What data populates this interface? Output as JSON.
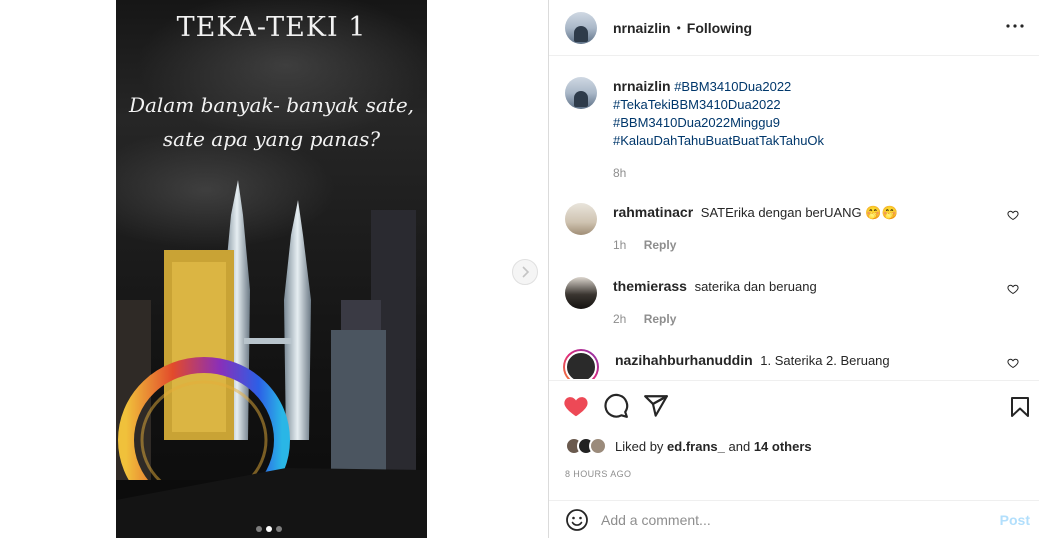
{
  "post": {
    "photo_title": "TEKA-TEKI 1",
    "photo_question_line1": "Dalam banyak- banyak sate,",
    "photo_question_line2": "sate apa yang panas?",
    "carousel_dots": 3,
    "carousel_active": 2
  },
  "header": {
    "username": "nrnaizlin",
    "separator": "•",
    "follow_status": "Following"
  },
  "caption": {
    "username": "nrnaizlin",
    "hashtags": [
      "#BBM3410Dua2022",
      "#TekaTekiBBM3410Dua2022",
      "#BBM3410Dua2022Minggu9",
      "#KalauDahTahuBuatBuatTakTahuOk"
    ],
    "time": "8h"
  },
  "comments": [
    {
      "username": "rahmatinacr",
      "text": "SATErika dengan berUANG 🤭🤭",
      "time": "1h",
      "reply": "Reply"
    },
    {
      "username": "themierass",
      "text": "saterika dan beruang",
      "time": "2h",
      "reply": "Reply"
    },
    {
      "username": "nazihahburhanuddin",
      "text": "1. Saterika 2. Beruang"
    }
  ],
  "likes": {
    "prefix": "Liked by",
    "user": "ed.frans_",
    "conjunction": "and",
    "others": "14 others"
  },
  "timestamp": "8 HOURS AGO",
  "add_comment": {
    "placeholder": "Add a comment...",
    "post_label": "Post"
  },
  "colors": {
    "liked_heart": "#ed4956",
    "hashtag": "#00376b",
    "post_disabled": "#b2dffc"
  }
}
